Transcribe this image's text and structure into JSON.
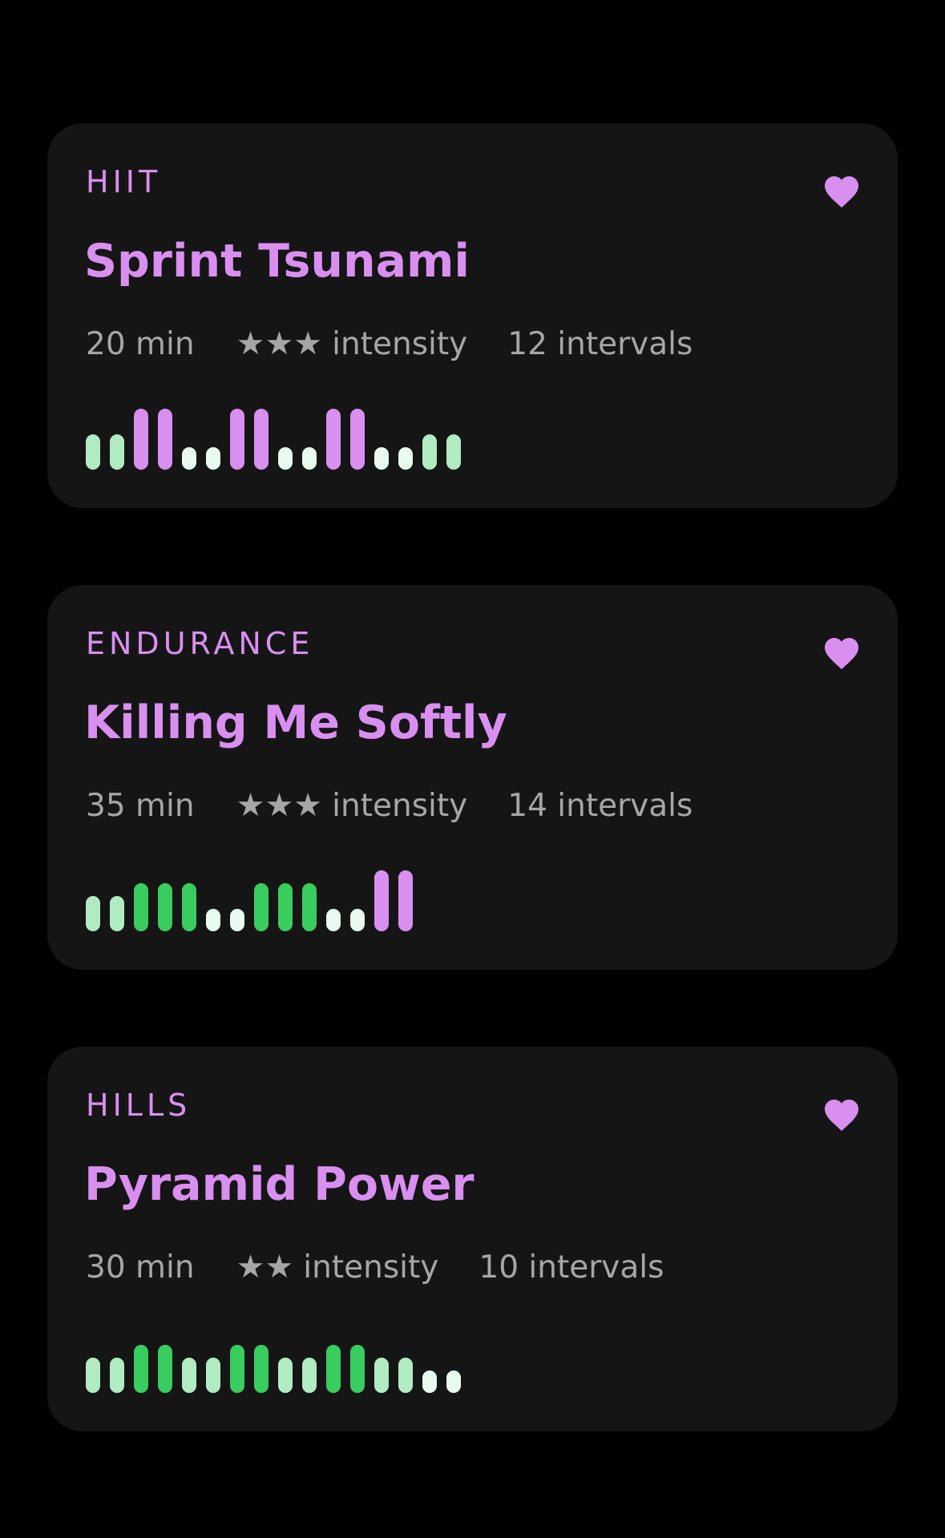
{
  "colors": {
    "accent": "#d98ff0",
    "card_bg": "#151515",
    "meta_text": "#a6a6a6",
    "bar_white": "#e9fbee",
    "bar_light_green": "#b1ebc2",
    "bar_green": "#39cc5e",
    "bar_purple": "#d98ff0"
  },
  "workouts": [
    {
      "category": "HIIT",
      "title": "Sprint Tsunami",
      "duration": "20 min",
      "stars": "★★★",
      "intensity_label": "intensity",
      "intervals": "12 intervals",
      "favorite_icon": "heart-icon",
      "bars": [
        {
          "level": 2,
          "color": "light_green"
        },
        {
          "level": 2,
          "color": "light_green"
        },
        {
          "level": 4,
          "color": "purple"
        },
        {
          "level": 4,
          "color": "purple"
        },
        {
          "level": 1,
          "color": "white"
        },
        {
          "level": 1,
          "color": "white"
        },
        {
          "level": 4,
          "color": "purple"
        },
        {
          "level": 4,
          "color": "purple"
        },
        {
          "level": 1,
          "color": "white"
        },
        {
          "level": 1,
          "color": "white"
        },
        {
          "level": 4,
          "color": "purple"
        },
        {
          "level": 4,
          "color": "purple"
        },
        {
          "level": 1,
          "color": "white"
        },
        {
          "level": 1,
          "color": "white"
        },
        {
          "level": 2,
          "color": "light_green"
        },
        {
          "level": 2,
          "color": "light_green"
        }
      ]
    },
    {
      "category": "ENDURANCE",
      "title": "Killing Me Softly",
      "duration": "35 min",
      "stars": "★★★",
      "intensity_label": "intensity",
      "intervals": "14 intervals",
      "favorite_icon": "heart-icon",
      "bars": [
        {
          "level": 2,
          "color": "light_green"
        },
        {
          "level": 2,
          "color": "light_green"
        },
        {
          "level": 3,
          "color": "green"
        },
        {
          "level": 3,
          "color": "green"
        },
        {
          "level": 3,
          "color": "green"
        },
        {
          "level": 1,
          "color": "white"
        },
        {
          "level": 1,
          "color": "white"
        },
        {
          "level": 3,
          "color": "green"
        },
        {
          "level": 3,
          "color": "green"
        },
        {
          "level": 3,
          "color": "green"
        },
        {
          "level": 1,
          "color": "white"
        },
        {
          "level": 1,
          "color": "white"
        },
        {
          "level": 4,
          "color": "purple"
        },
        {
          "level": 4,
          "color": "purple"
        }
      ]
    },
    {
      "category": "HILLS",
      "title": "Pyramid Power",
      "duration": "30 min",
      "stars": "★★",
      "intensity_label": "intensity",
      "intervals": "10 intervals",
      "favorite_icon": "heart-icon",
      "bars": [
        {
          "level": 2,
          "color": "light_green"
        },
        {
          "level": 2,
          "color": "light_green"
        },
        {
          "level": 3,
          "color": "green"
        },
        {
          "level": 3,
          "color": "green"
        },
        {
          "level": 2,
          "color": "light_green"
        },
        {
          "level": 2,
          "color": "light_green"
        },
        {
          "level": 3,
          "color": "green"
        },
        {
          "level": 3,
          "color": "green"
        },
        {
          "level": 2,
          "color": "light_green"
        },
        {
          "level": 2,
          "color": "light_green"
        },
        {
          "level": 3,
          "color": "green"
        },
        {
          "level": 3,
          "color": "green"
        },
        {
          "level": 2,
          "color": "light_green"
        },
        {
          "level": 2,
          "color": "light_green"
        },
        {
          "level": 1,
          "color": "white"
        },
        {
          "level": 1,
          "color": "white"
        }
      ]
    }
  ]
}
